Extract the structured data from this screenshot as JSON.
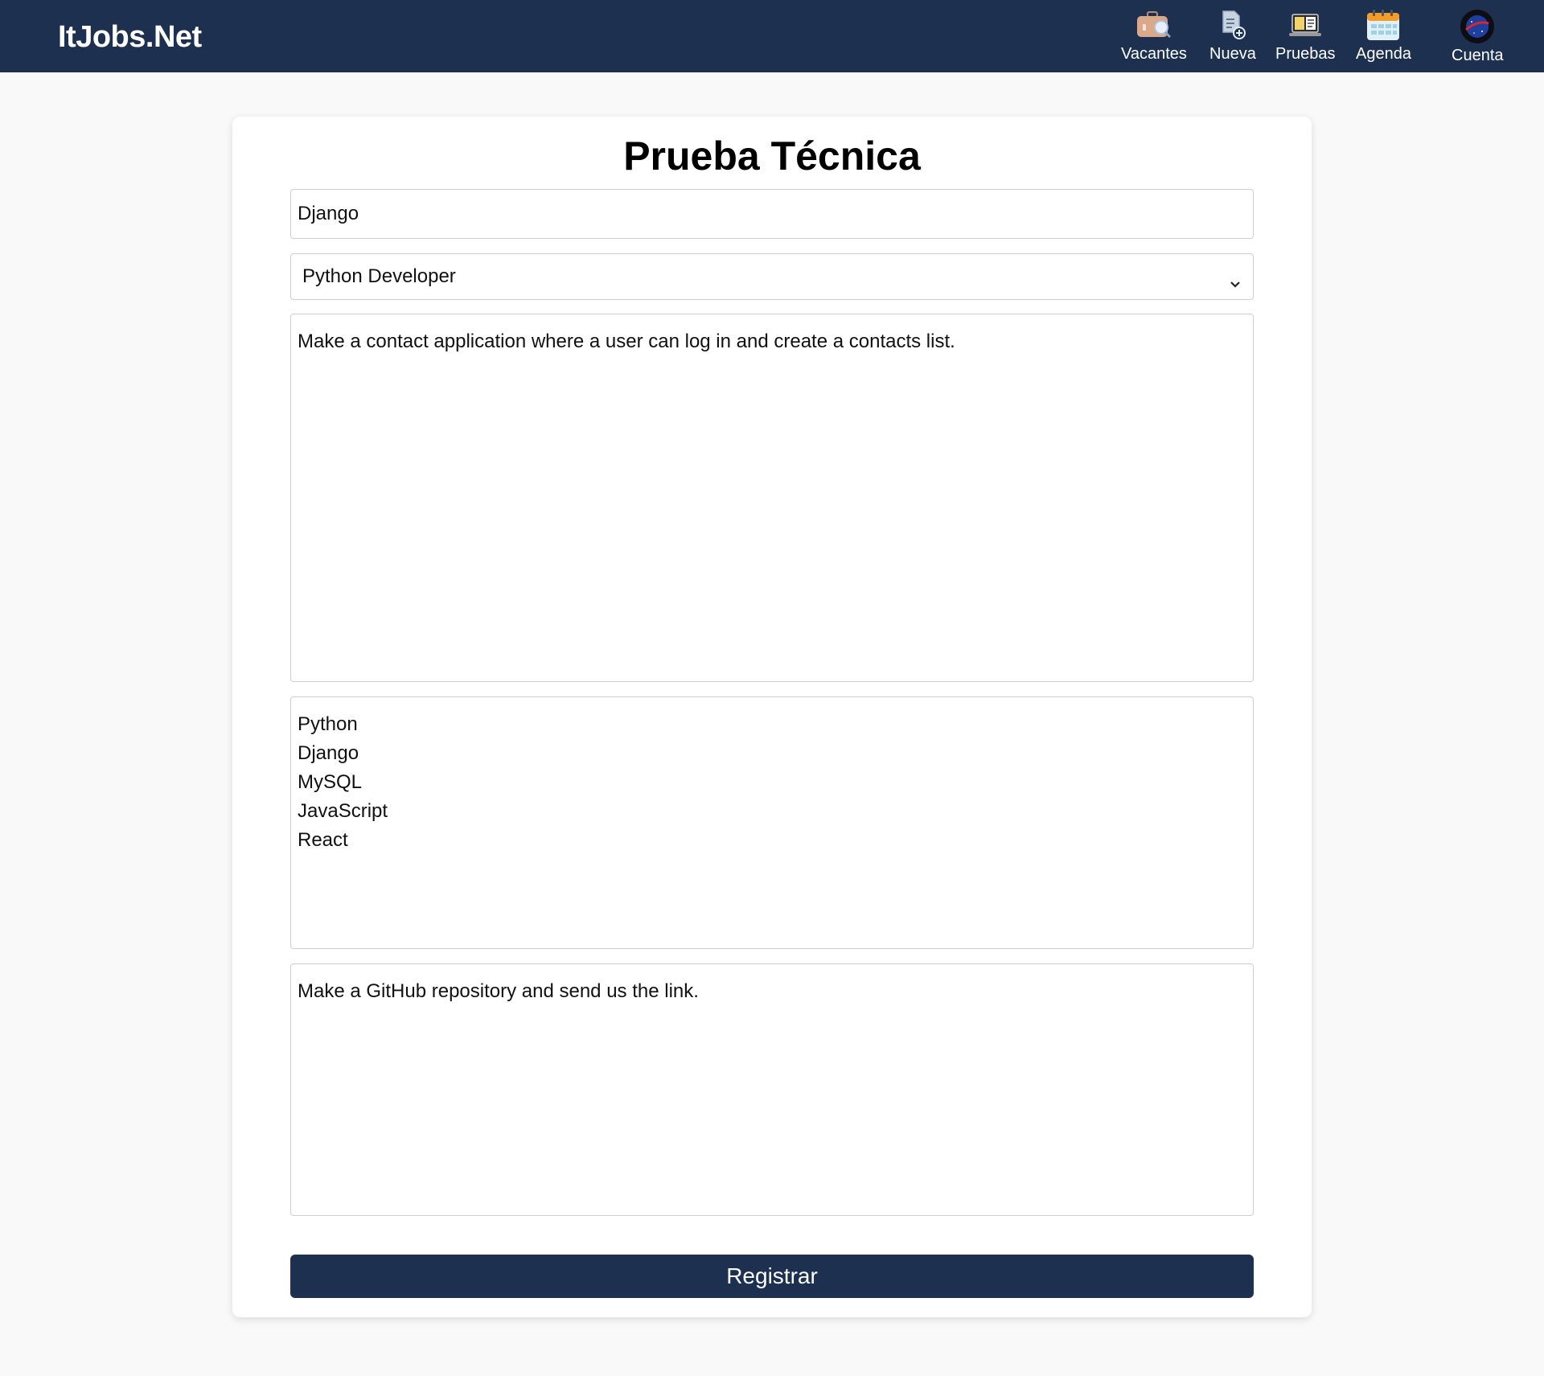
{
  "navbar": {
    "brand": "ItJobs.Net",
    "items": [
      {
        "label": "Vacantes",
        "icon": "briefcase-search-icon"
      },
      {
        "label": "Nueva",
        "icon": "new-document-icon"
      },
      {
        "label": "Pruebas",
        "icon": "laptop-code-icon"
      },
      {
        "label": "Agenda",
        "icon": "calendar-icon"
      },
      {
        "label": "Cuenta",
        "icon": "avatar-icon"
      }
    ],
    "colors": {
      "background": "#1d3050",
      "text": "#ffffff"
    }
  },
  "form": {
    "title": "Prueba Técnica",
    "name_value": "Django",
    "role_selected": "Python Developer",
    "description_value": "Make a contact application where a user can log in and create a contacts list.",
    "skills_lines": [
      "Python",
      "Django",
      "MySQL",
      "JavaScript",
      "React"
    ],
    "instructions_value": "Make a GitHub repository and send us the link.",
    "submit_label": "Registrar"
  }
}
